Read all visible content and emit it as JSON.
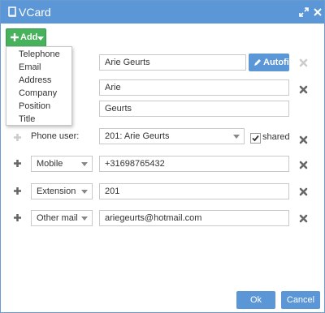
{
  "window": {
    "title": "VCard"
  },
  "toolbar": {
    "add_label": "Add"
  },
  "add_menu": {
    "items": [
      "Telephone",
      "Email",
      "Address",
      "Company",
      "Position",
      "Title"
    ]
  },
  "fields": {
    "display_name": "Arie Geurts",
    "first_name": "Arie",
    "last_name": "Geurts",
    "phone_user_label": "Phone user:",
    "phone_user_value": "201: Arie Geurts",
    "shared_label": "shared",
    "shared_checked": true
  },
  "buttons": {
    "autofill": "Autofill",
    "ok": "Ok",
    "cancel": "Cancel"
  },
  "rows": [
    {
      "type": "Mobile",
      "value": "+31698765432"
    },
    {
      "type": "Extension",
      "value": "201"
    },
    {
      "type": "Other mail",
      "value": "ariegeurts@hotmail.com"
    }
  ],
  "colors": {
    "titlebar": "#5b97d7",
    "add": "#47b25c",
    "primary": "#5b97d7"
  }
}
